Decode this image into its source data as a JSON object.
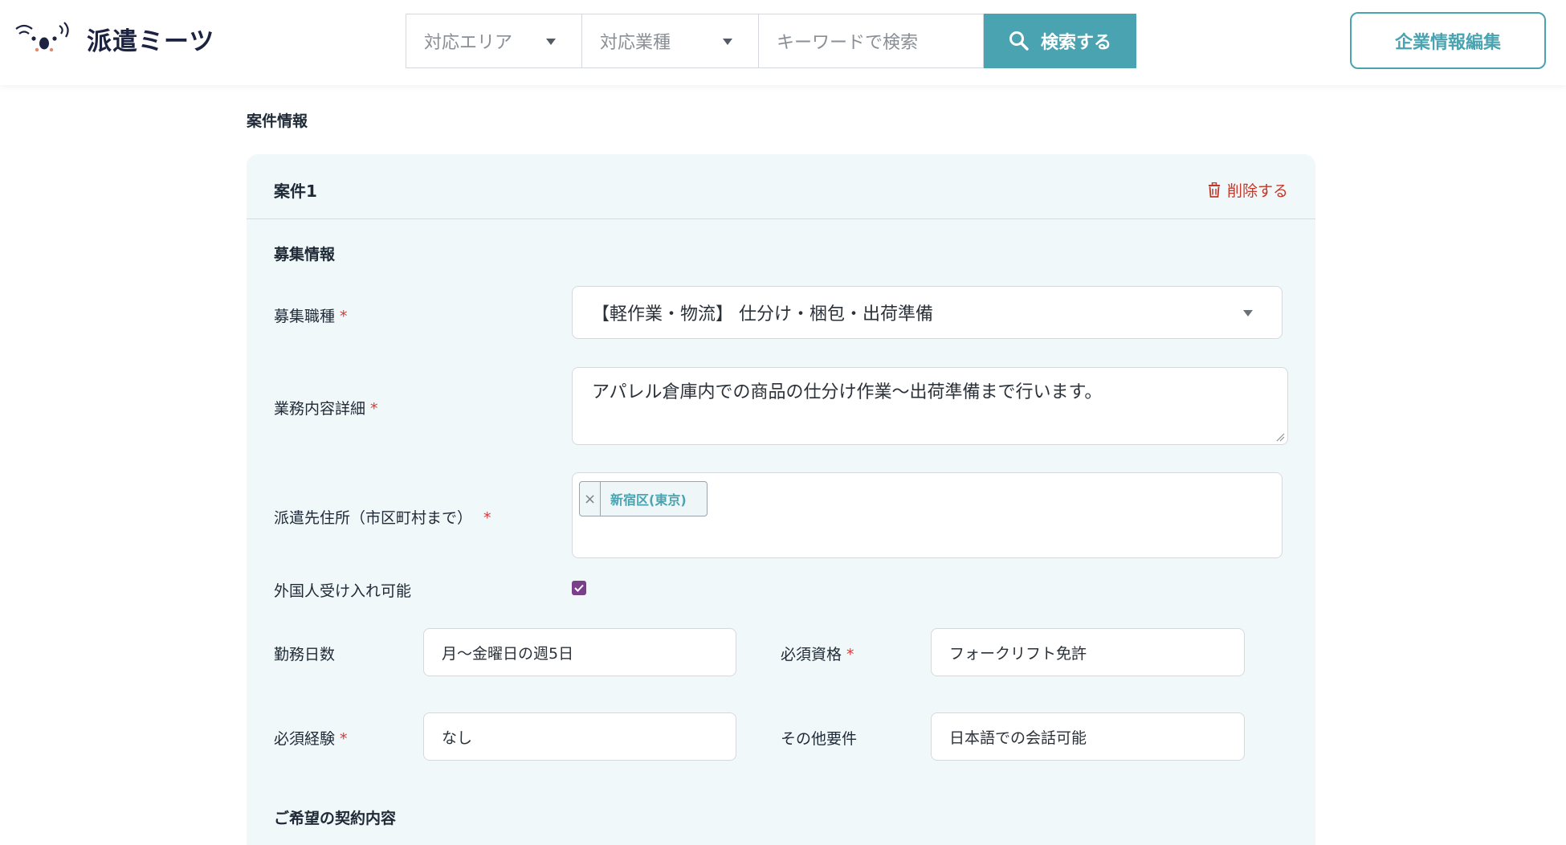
{
  "header": {
    "logo_text": "派遣ミーツ",
    "area_select": "対応エリア",
    "industry_select": "対応業種",
    "keyword_placeholder": "キーワードで検索",
    "search_button": "検索する",
    "edit_company_button": "企業情報編集"
  },
  "page": {
    "section_title": "案件情報"
  },
  "case": {
    "title": "案件1",
    "delete_label": "削除する",
    "recruit_heading": "募集情報",
    "contract_heading": "ご希望の契約内容",
    "job_type": {
      "label": "募集職種",
      "required_mark": "*",
      "value": "【軽作業・物流】 仕分け・梱包・出荷準備"
    },
    "job_detail": {
      "label": "業務内容詳細",
      "required_mark": "*",
      "value": "アパレル倉庫内での商品の仕分け作業〜出荷準備まで行います。"
    },
    "dispatch_address": {
      "label": "派遣先住所（市区町村まで）",
      "required_mark": "*",
      "tags": [
        "新宿区(東京)"
      ],
      "remove_glyph": "×"
    },
    "foreigner_ok": {
      "label": "外国人受け入れ可能",
      "checked": true
    },
    "work_days": {
      "label": "勤務日数",
      "value": "月〜金曜日の週5日"
    },
    "required_qualification": {
      "label": "必須資格",
      "required_mark": "*",
      "value": "フォークリフト免許"
    },
    "required_experience": {
      "label": "必須経験",
      "required_mark": "*",
      "value": "なし"
    },
    "other_requirements": {
      "label": "その他要件",
      "value": "日本語での会話可能"
    }
  },
  "colors": {
    "accent": "#4aa3b0",
    "danger": "#c0392b",
    "card_bg": "#f1f8fa",
    "checkbox": "#7a3f8a"
  }
}
